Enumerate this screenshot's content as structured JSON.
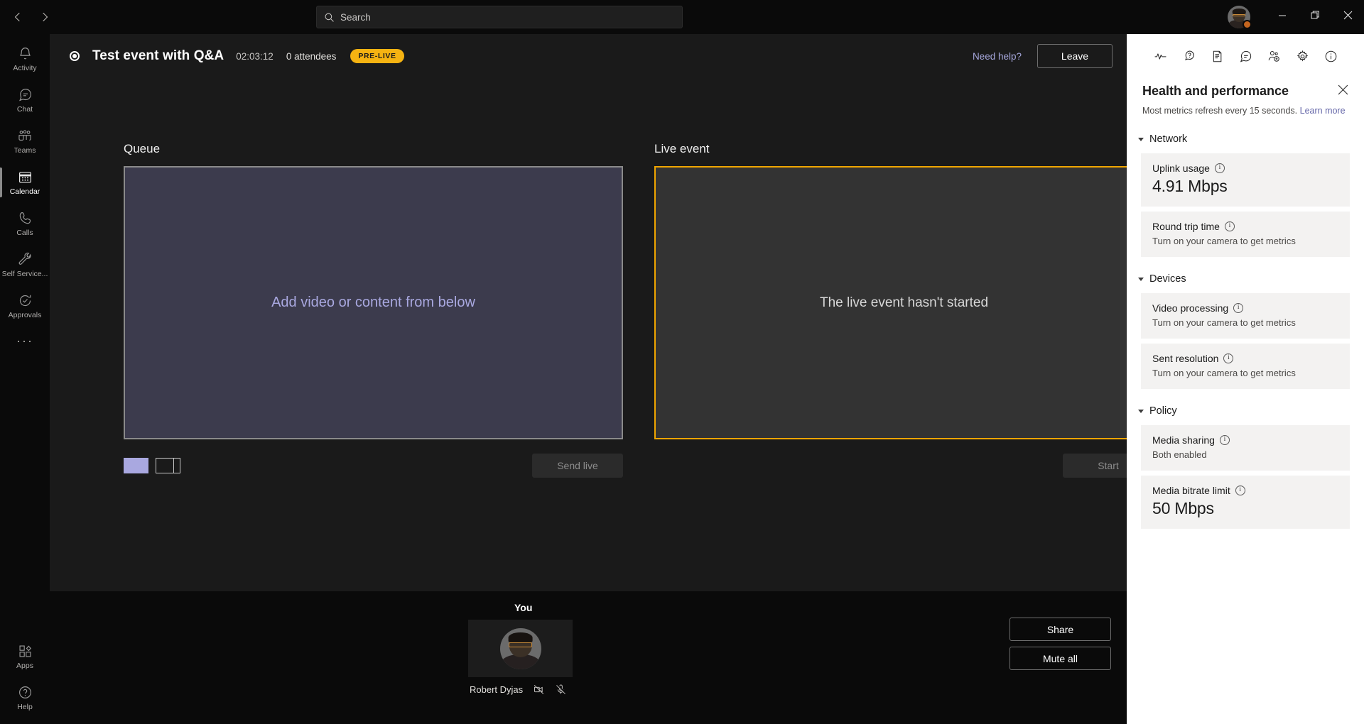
{
  "titlebar": {
    "back_icon": "chevron-left-icon",
    "forward_icon": "chevron-right-icon",
    "search_placeholder": "Search",
    "minimize_label": "Minimize",
    "restore_label": "Restore",
    "close_label": "Close"
  },
  "rail": {
    "items": [
      {
        "label": "Activity",
        "icon": "bell-icon",
        "active": false
      },
      {
        "label": "Chat",
        "icon": "chat-icon",
        "active": false
      },
      {
        "label": "Teams",
        "icon": "teams-icon",
        "active": false
      },
      {
        "label": "Calendar",
        "icon": "calendar-icon",
        "active": true
      },
      {
        "label": "Calls",
        "icon": "phone-icon",
        "active": false
      },
      {
        "label": "Self Service...",
        "icon": "wrench-icon",
        "active": false
      },
      {
        "label": "Approvals",
        "icon": "approvals-icon",
        "active": false
      }
    ],
    "more_label": "···",
    "bottom_items": [
      {
        "label": "Apps",
        "icon": "apps-icon"
      },
      {
        "label": "Help",
        "icon": "help-icon"
      }
    ]
  },
  "event_header": {
    "record_icon": "record-indicator-icon",
    "title": "Test event with Q&A",
    "timer": "02:03:12",
    "attendees": "0 attendees",
    "status_badge": "PRE-LIVE",
    "need_help": "Need help?",
    "leave_label": "Leave",
    "badge_color": "#f5b312"
  },
  "queue_panel": {
    "title": "Queue",
    "placeholder": "Add video or content from below",
    "layout_solid_label": "Single layout",
    "layout_split_label": "Split layout",
    "send_live_label": "Send live",
    "accent_color": "#a9a8e0"
  },
  "live_panel": {
    "title": "Live event",
    "placeholder": "The live event hasn't started",
    "start_label": "Start",
    "accent_color": "#f0a500"
  },
  "bottom": {
    "you_label": "You",
    "participant_name": "Robert Dyjas",
    "camera_icon": "camera-off-icon",
    "mic_icon": "mic-off-icon",
    "share_label": "Share",
    "mute_all_label": "Mute all"
  },
  "right_panel": {
    "icons": [
      {
        "name": "health-pulse-icon",
        "label": "Health and performance"
      },
      {
        "name": "qa-icon",
        "label": "Q&A"
      },
      {
        "name": "notes-icon",
        "label": "Notes"
      },
      {
        "name": "chat-icon",
        "label": "Chat"
      },
      {
        "name": "add-people-icon",
        "label": "Add people"
      },
      {
        "name": "settings-gear-icon",
        "label": "Settings"
      },
      {
        "name": "info-icon",
        "label": "Info"
      }
    ],
    "title": "Health and performance",
    "close_label": "Close",
    "subtitle": "Most metrics refresh every 15 seconds.",
    "learn_more": "Learn more",
    "sections": [
      {
        "title": "Network",
        "metrics": [
          {
            "label": "Uplink usage",
            "value": "4.91 Mbps",
            "value_kind": "big"
          },
          {
            "label": "Round trip time",
            "value": "Turn on your camera to get metrics",
            "value_kind": "small"
          }
        ]
      },
      {
        "title": "Devices",
        "metrics": [
          {
            "label": "Video processing",
            "value": "Turn on your camera to get metrics",
            "value_kind": "small"
          },
          {
            "label": "Sent resolution",
            "value": "Turn on your camera to get metrics",
            "value_kind": "small"
          }
        ]
      },
      {
        "title": "Policy",
        "metrics": [
          {
            "label": "Media sharing",
            "value": "Both enabled",
            "value_kind": "small"
          },
          {
            "label": "Media bitrate limit",
            "value": "50 Mbps",
            "value_kind": "big"
          }
        ]
      }
    ]
  }
}
